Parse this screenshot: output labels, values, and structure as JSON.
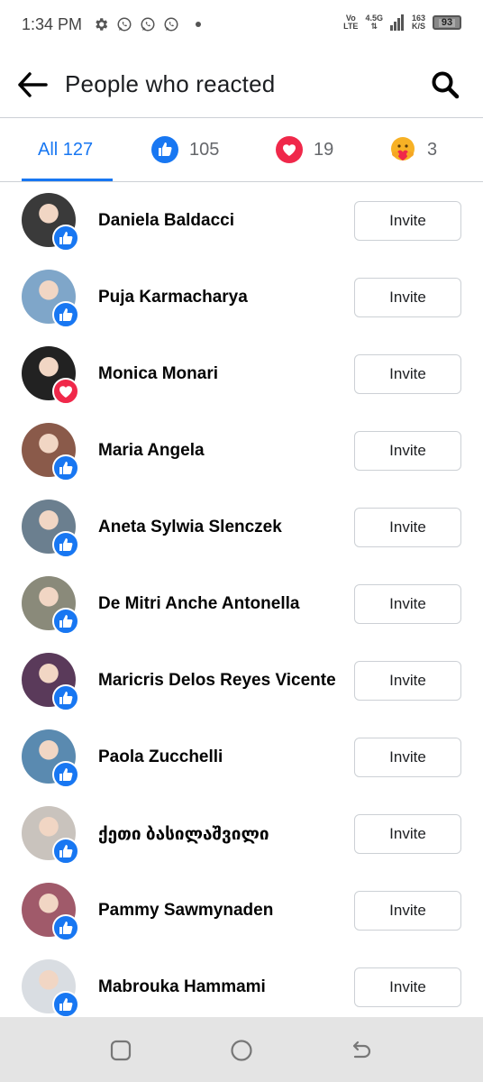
{
  "status_bar": {
    "time": "1:34 PM",
    "network_top": "Vo",
    "network_bottom": "LTE",
    "signal_type": "4.5G",
    "speed_value": "163",
    "speed_unit": "K/S",
    "battery": "93"
  },
  "header": {
    "title": "People who reacted"
  },
  "tabs": [
    {
      "label": "All 127",
      "icon": "none"
    },
    {
      "label": "105",
      "icon": "like-icon"
    },
    {
      "label": "19",
      "icon": "love-icon"
    },
    {
      "label": "3",
      "icon": "care-icon"
    }
  ],
  "people": [
    {
      "name": "Daniela Baldacci",
      "reaction": "like",
      "avatar_color": "#3a3a3a"
    },
    {
      "name": "Puja Karmacharya",
      "reaction": "like",
      "avatar_color": "#7fa6c9"
    },
    {
      "name": "Monica Monari",
      "reaction": "love",
      "avatar_color": "#222222"
    },
    {
      "name": "Maria Angela",
      "reaction": "like",
      "avatar_color": "#8a5a4a"
    },
    {
      "name": "Aneta Sylwia Slenczek",
      "reaction": "like",
      "avatar_color": "#6b7f8f"
    },
    {
      "name": "De Mitri Anche Antonella",
      "reaction": "like",
      "avatar_color": "#8a8a7a"
    },
    {
      "name": "Maricris Delos Reyes Vicente",
      "reaction": "like",
      "avatar_color": "#5a3a5a"
    },
    {
      "name": "Paola Zucchelli",
      "reaction": "like",
      "avatar_color": "#5a8ab0"
    },
    {
      "name": "ქეთი ბასილაშვილი",
      "reaction": "like",
      "avatar_color": "#c9c3bd"
    },
    {
      "name": "Pammy Sawmynaden",
      "reaction": "like",
      "avatar_color": "#a05a6a"
    },
    {
      "name": "Mabrouka Hammami",
      "reaction": "like",
      "avatar_color": "#d9dde2"
    }
  ],
  "invite_label": "Invite",
  "colors": {
    "accent": "#1877f2",
    "love": "#f0284a",
    "divider": "#ccd0d5"
  }
}
